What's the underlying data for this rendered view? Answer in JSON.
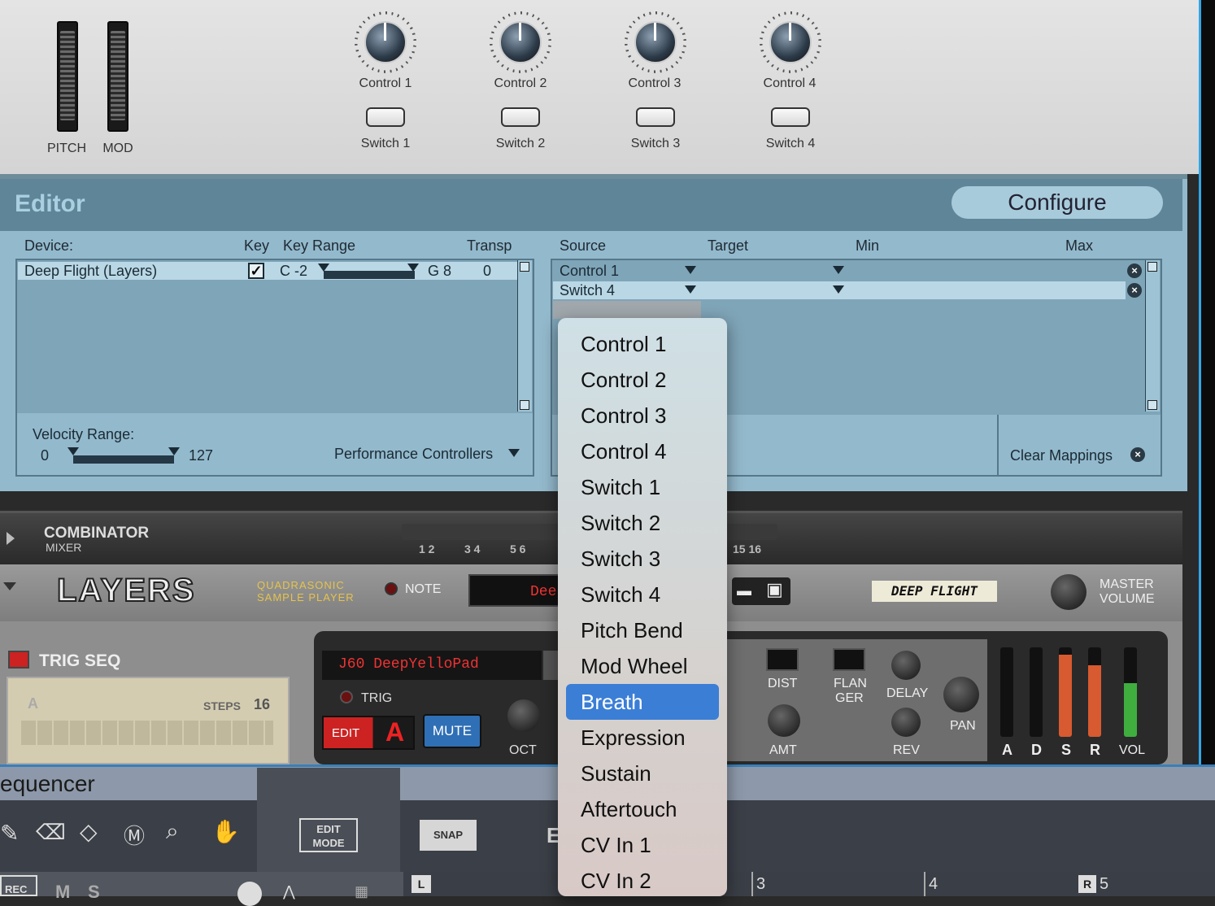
{
  "top_panel": {
    "wheels": [
      {
        "label": "PITCH"
      },
      {
        "label": "MOD"
      }
    ],
    "controls": [
      {
        "knob": "Control 1",
        "switch": "Switch 1"
      },
      {
        "knob": "Control 2",
        "switch": "Switch 2"
      },
      {
        "knob": "Control 3",
        "switch": "Switch 3"
      },
      {
        "knob": "Control 4",
        "switch": "Switch 4"
      }
    ]
  },
  "editor": {
    "title": "Editor",
    "configure_label": "Configure",
    "device_headers": {
      "device": "Device:",
      "key": "Key",
      "key_range": "Key Range",
      "transp": "Transp"
    },
    "device_row": {
      "name": "Deep Flight (Layers)",
      "key_checked": true,
      "range_low": "C -2",
      "range_high": "G 8",
      "transp": "0"
    },
    "velocity": {
      "label": "Velocity Range:",
      "min": "0",
      "max": "127"
    },
    "perf_controllers_label": "Performance Controllers",
    "mapping_headers": {
      "source": "Source",
      "target": "Target",
      "min": "Min",
      "max": "Max"
    },
    "mappings": [
      {
        "source": "Control 1",
        "target": ""
      },
      {
        "source": "Switch 4",
        "target": ""
      }
    ],
    "clear_label": "Clear Mappings",
    "icons": {
      "remove": "remove-icon",
      "check": "check-icon",
      "dropdown": "triangle-down-icon"
    }
  },
  "combinator": {
    "title": "COMBINATOR",
    "subtitle": "MIXER",
    "channels": [
      "1 2",
      "3 4",
      "5 6",
      "15 16"
    ]
  },
  "layers": {
    "logo": "LAYERS",
    "tag1": "QUADRASONIC",
    "tag2": "SAMPLE PLAYER",
    "note_label": "NOTE",
    "display_text": "Dee",
    "patch_label": "DEEP FLIGHT",
    "master_label1": "MASTER",
    "master_label2": "VOLUME"
  },
  "trigseq": {
    "label": "TRIG SEQ",
    "steps_label": "STEPS",
    "steps_value": "16",
    "pattern": "A"
  },
  "layer_panel": {
    "patch_name": "J60 DeepYelloPad",
    "trig": "TRIG",
    "edit": "EDIT",
    "letter": "A",
    "mute": "MUTE",
    "oct": "OCT",
    "dist": "DIST",
    "amt": "AMT",
    "flanger_1": "FLAN",
    "flanger_2": "GER",
    "delay": "DELAY",
    "rev": "REV",
    "pan": "PAN",
    "adsr": [
      "A",
      "D",
      "S",
      "R"
    ],
    "vol": "VOL"
  },
  "sequencer": {
    "title": "equencer",
    "edit_mode_1": "EDIT",
    "edit_mode_2": "MODE",
    "snap": "SNAP",
    "letter": "E",
    "rec": "REC",
    "m": "M",
    "s": "S",
    "ruler": [
      "3",
      "4",
      "5"
    ],
    "left_marker": "L",
    "right_marker": "R"
  },
  "dropdown": {
    "items": [
      "Control 1",
      "Control 2",
      "Control 3",
      "Control 4",
      "Switch 1",
      "Switch 2",
      "Switch 3",
      "Switch 4",
      "Pitch Bend",
      "Mod Wheel",
      "Breath",
      "Expression",
      "Sustain",
      "Aftertouch",
      "CV In 1",
      "CV In 2"
    ],
    "selected": "Breath"
  },
  "colors": {
    "accent": "#3b7ed6",
    "editor_bg": "#93b9cc",
    "edge": "#2fa8e6"
  }
}
